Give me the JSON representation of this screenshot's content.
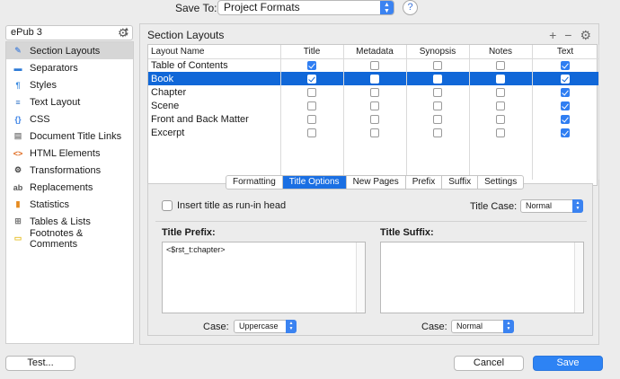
{
  "topbar": {
    "save_to_label": "Save To:",
    "save_to_value": "Project Formats",
    "help_label": "?"
  },
  "sidebar": {
    "format_value": "ePub 3",
    "items": [
      {
        "label": "Section Layouts",
        "icon": "section-layouts-icon",
        "glyph": "✎",
        "color": "#6a96d8",
        "selected": true
      },
      {
        "label": "Separators",
        "icon": "separators-icon",
        "glyph": "▬",
        "color": "#2d7ad6"
      },
      {
        "label": "Styles",
        "icon": "styles-icon",
        "glyph": "¶",
        "color": "#3b8be0"
      },
      {
        "label": "Text Layout",
        "icon": "text-layout-icon",
        "glyph": "≡",
        "color": "#2f73c7"
      },
      {
        "label": "CSS",
        "icon": "css-icon",
        "glyph": "{}",
        "color": "#3b82e6"
      },
      {
        "label": "Document Title Links",
        "icon": "document-icon",
        "glyph": "▤",
        "color": "#8a8a8a"
      },
      {
        "label": "HTML Elements",
        "icon": "html-icon",
        "glyph": "<>",
        "color": "#e06a1f"
      },
      {
        "label": "Transformations",
        "icon": "transformations-icon",
        "glyph": "⚙",
        "color": "#444444"
      },
      {
        "label": "Replacements",
        "icon": "replacements-icon",
        "glyph": "ab",
        "color": "#555555"
      },
      {
        "label": "Statistics",
        "icon": "statistics-icon",
        "glyph": "▮",
        "color": "#e58a1f"
      },
      {
        "label": "Tables & Lists",
        "icon": "tables-icon",
        "glyph": "⊞",
        "color": "#777777"
      },
      {
        "label": "Footnotes & Comments",
        "icon": "footnotes-icon",
        "glyph": "▭",
        "color": "#e6c02b"
      }
    ]
  },
  "main": {
    "title": "Section Layouts",
    "columns": [
      "Layout Name",
      "Title",
      "Metadata",
      "Synopsis",
      "Notes",
      "Text"
    ],
    "rows": [
      {
        "name": "Table of Contents",
        "checks": [
          true,
          false,
          false,
          false,
          true
        ],
        "selected": false
      },
      {
        "name": "Book",
        "checks": [
          true,
          false,
          false,
          false,
          true
        ],
        "selected": true
      },
      {
        "name": "Chapter",
        "checks": [
          false,
          false,
          false,
          false,
          true
        ],
        "selected": false
      },
      {
        "name": "Scene",
        "checks": [
          false,
          false,
          false,
          false,
          true
        ],
        "selected": false
      },
      {
        "name": "Front and Back Matter",
        "checks": [
          false,
          false,
          false,
          false,
          true
        ],
        "selected": false
      },
      {
        "name": "Excerpt",
        "checks": [
          false,
          false,
          false,
          false,
          true
        ],
        "selected": false
      }
    ],
    "tabs": [
      "Formatting",
      "Title Options",
      "New Pages",
      "Prefix",
      "Suffix",
      "Settings"
    ],
    "active_tab": 1,
    "runin_label": "Insert title as run-in head",
    "title_case_label": "Title Case:",
    "title_case_value": "Normal",
    "prefix_label": "Title Prefix:",
    "prefix_value": "<$rst_t:chapter>",
    "suffix_label": "Title Suffix:",
    "suffix_value": "",
    "case_label": "Case:",
    "prefix_case_value": "Uppercase",
    "suffix_case_value": "Normal"
  },
  "buttons": {
    "test": "Test...",
    "cancel": "Cancel",
    "save": "Save"
  }
}
